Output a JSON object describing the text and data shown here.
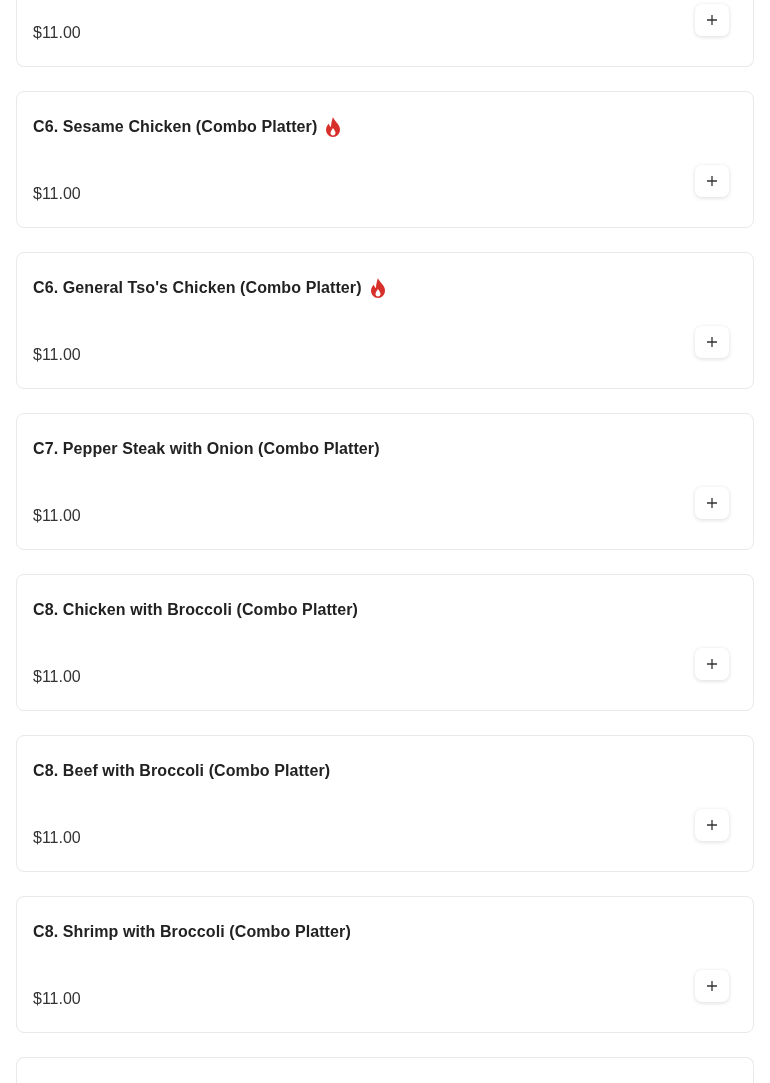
{
  "menu_items": [
    {
      "kind": "price_only",
      "price": "$11.00"
    },
    {
      "kind": "full",
      "title": "C6. Sesame Chicken (Combo Platter)",
      "spicy": true,
      "price": "$11.00"
    },
    {
      "kind": "full",
      "title": "C6. General Tso's Chicken (Combo Platter)",
      "spicy": true,
      "price": "$11.00"
    },
    {
      "kind": "full",
      "title": "C7. Pepper Steak with Onion (Combo Platter)",
      "spicy": false,
      "price": "$11.00"
    },
    {
      "kind": "full",
      "title": "C8. Chicken with Broccoli (Combo Platter)",
      "spicy": false,
      "price": "$11.00"
    },
    {
      "kind": "full",
      "title": "C8. Beef with Broccoli (Combo Platter)",
      "spicy": false,
      "price": "$11.00"
    },
    {
      "kind": "full",
      "title": "C8. Shrimp with Broccoli (Combo Platter)",
      "spicy": false,
      "price": "$11.00"
    },
    {
      "kind": "blank"
    }
  ]
}
